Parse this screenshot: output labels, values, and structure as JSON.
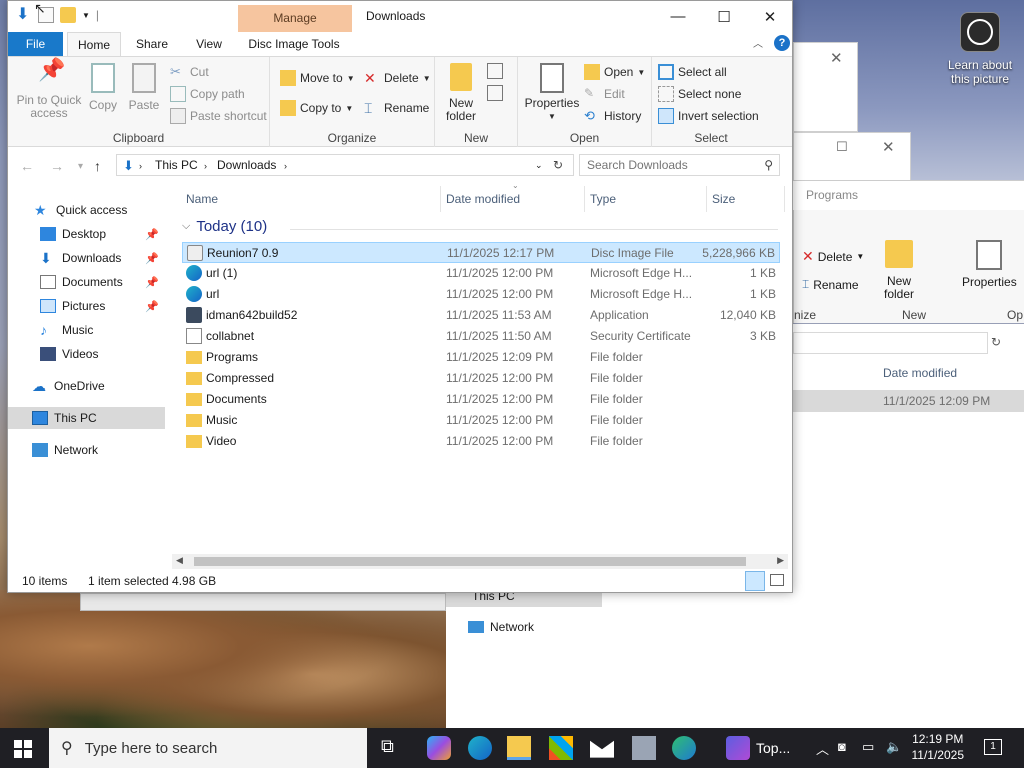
{
  "window": {
    "title": "Downloads",
    "context_tab": "Manage",
    "controls": {
      "minimize": "—",
      "maximize": "☐",
      "close": "✕"
    }
  },
  "ribbon_tabs": [
    "File",
    "Home",
    "Share",
    "View",
    "Disc Image Tools"
  ],
  "ribbon": {
    "clipboard": {
      "label": "Clipboard",
      "pin": "Pin to Quick access",
      "copy": "Copy",
      "paste": "Paste",
      "cut": "Cut",
      "copy_path": "Copy path",
      "paste_shortcut": "Paste shortcut"
    },
    "organize": {
      "label": "Organize",
      "move_to": "Move to",
      "copy_to": "Copy to",
      "delete": "Delete",
      "rename": "Rename"
    },
    "new": {
      "label": "New",
      "new_folder": "New folder"
    },
    "open": {
      "label": "Open",
      "properties": "Properties",
      "open": "Open",
      "edit": "Edit",
      "history": "History"
    },
    "select": {
      "label": "Select",
      "select_all": "Select all",
      "select_none": "Select none",
      "invert": "Invert selection"
    }
  },
  "address": {
    "crumbs": [
      "This PC",
      "Downloads"
    ],
    "search_placeholder": "Search Downloads"
  },
  "nav": [
    {
      "label": "Quick access"
    },
    {
      "label": "Desktop"
    },
    {
      "label": "Downloads"
    },
    {
      "label": "Documents"
    },
    {
      "label": "Pictures"
    },
    {
      "label": "Music"
    },
    {
      "label": "Videos"
    },
    {
      "label": "OneDrive"
    },
    {
      "label": "This PC"
    },
    {
      "label": "Network"
    }
  ],
  "columns": {
    "name": "Name",
    "date": "Date modified",
    "type": "Type",
    "size": "Size"
  },
  "group": "Today (10)",
  "files": [
    {
      "name": "Reunion7 0.9",
      "date": "11/1/2025 12:17 PM",
      "type": "Disc Image File",
      "size": "5,228,966 KB"
    },
    {
      "name": "url (1)",
      "date": "11/1/2025 12:00 PM",
      "type": "Microsoft Edge H...",
      "size": "1 KB"
    },
    {
      "name": "url",
      "date": "11/1/2025 12:00 PM",
      "type": "Microsoft Edge H...",
      "size": "1 KB"
    },
    {
      "name": "idman642build52",
      "date": "11/1/2025 11:53 AM",
      "type": "Application",
      "size": "12,040 KB"
    },
    {
      "name": "collabnet",
      "date": "11/1/2025 11:50 AM",
      "type": "Security Certificate",
      "size": "3 KB"
    },
    {
      "name": "Programs",
      "date": "11/1/2025 12:09 PM",
      "type": "File folder",
      "size": ""
    },
    {
      "name": "Compressed",
      "date": "11/1/2025 12:00 PM",
      "type": "File folder",
      "size": ""
    },
    {
      "name": "Documents",
      "date": "11/1/2025 12:00 PM",
      "type": "File folder",
      "size": ""
    },
    {
      "name": "Music",
      "date": "11/1/2025 12:00 PM",
      "type": "File folder",
      "size": ""
    },
    {
      "name": "Video",
      "date": "11/1/2025 12:00 PM",
      "type": "File folder",
      "size": ""
    }
  ],
  "status": {
    "count": "10 items",
    "selected": "1 item selected  4.98 GB"
  },
  "background": {
    "learn": "Learn about this picture",
    "programs_title": "Programs",
    "delete": "Delete",
    "rename": "Rename",
    "new_folder": "New folder",
    "properties": "Properties",
    "new_label": "New",
    "op_label": "Op",
    "nize_label": "nize",
    "date_modified": "Date modified",
    "row_date": "11/1/2025 12:09 PM",
    "this_pc": "This PC",
    "network": "Network"
  },
  "taskbar": {
    "search_placeholder": "Type here to search",
    "app_label": "Top...",
    "time": "12:19 PM",
    "date": "11/1/2025",
    "notifications": "1"
  },
  "colors": {
    "file_tab": "#1979ca",
    "manage": "#f6c59f",
    "selection": "#cce8ff",
    "group_text": "#1e3287"
  }
}
